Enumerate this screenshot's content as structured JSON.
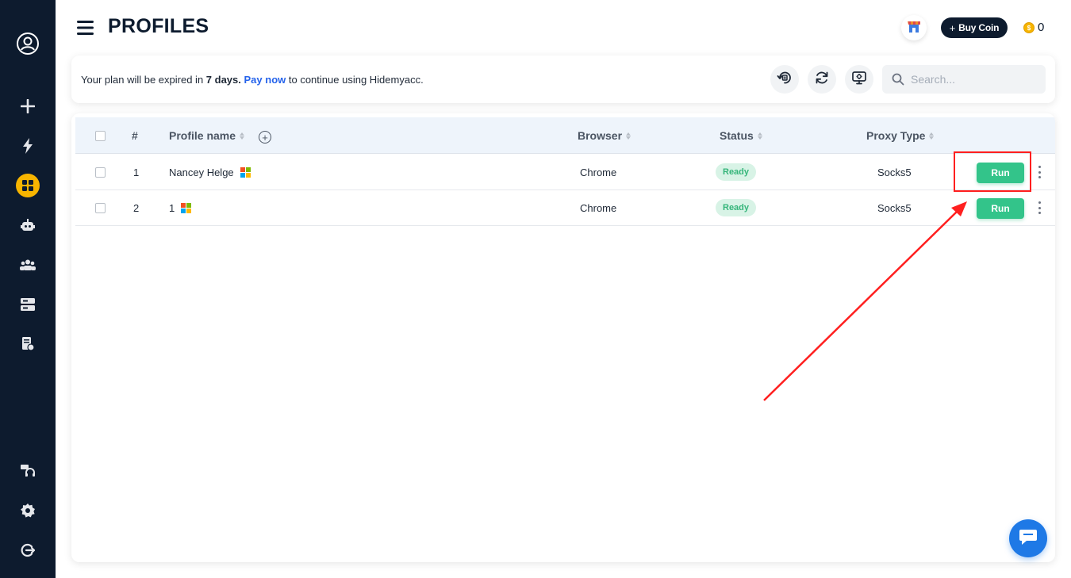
{
  "sidebar": {
    "items": [
      {
        "name": "account",
        "icon": "user-circle-icon"
      },
      {
        "name": "create",
        "icon": "plus-icon"
      },
      {
        "name": "quick",
        "icon": "lightning-icon"
      },
      {
        "name": "profiles",
        "icon": "grid-icon",
        "active": true
      },
      {
        "name": "automation",
        "icon": "robot-icon"
      },
      {
        "name": "team",
        "icon": "team-icon"
      },
      {
        "name": "proxies",
        "icon": "server-icon"
      },
      {
        "name": "billing",
        "icon": "invoice-icon"
      },
      {
        "name": "support",
        "icon": "headset-icon"
      },
      {
        "name": "settings",
        "icon": "gear-icon"
      },
      {
        "name": "logout",
        "icon": "logout-icon"
      }
    ],
    "bg_color": "#0d1b2e",
    "active_color": "#f7b500"
  },
  "header": {
    "title": "PROFILES",
    "buy_coin_label": "Buy Coin",
    "buy_coin_plus": "+",
    "coin_count": "0",
    "coin_symbol": "$"
  },
  "notice": {
    "prefix": "Your plan will be expired in ",
    "days": "7 days.",
    "pay_link": "Pay now",
    "suffix": " to continue using Hidemyacc."
  },
  "search": {
    "placeholder": "Search..."
  },
  "table": {
    "columns": {
      "index": "#",
      "profile_name": "Profile name",
      "browser": "Browser",
      "status": "Status",
      "proxy_type": "Proxy Type"
    },
    "add_column_symbol": "+",
    "rows": [
      {
        "index": "1",
        "name": "Nancey Helge",
        "browser": "Chrome",
        "status": "Ready",
        "proxy": "Socks5",
        "action": "Run"
      },
      {
        "index": "2",
        "name": "1",
        "browser": "Chrome",
        "status": "Ready",
        "proxy": "Socks5",
        "action": "Run"
      }
    ]
  },
  "colors": {
    "run_button": "#33c48a",
    "status_ready_bg": "#d8f3e6",
    "status_ready_text": "#35b57a",
    "link": "#2563eb",
    "annotation": "#ff1f1f",
    "chat": "#1e79e6"
  }
}
